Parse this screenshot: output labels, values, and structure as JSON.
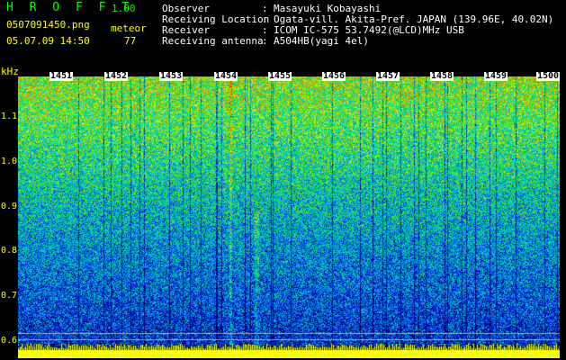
{
  "app": {
    "title": "H R O F F T",
    "version": "1.00"
  },
  "file": {
    "name": "0507091450.png",
    "datetime": "05.07.09 14:50"
  },
  "meteor": {
    "label": "meteor",
    "count": "77"
  },
  "info": [
    {
      "key": "Observer",
      "value": "Masayuki Kobayashi"
    },
    {
      "key": "Receiving Location",
      "value": "Ogata-vill. Akita-Pref. JAPAN (139.96E, 40.02N)"
    },
    {
      "key": "Receiver",
      "value": "ICOM IC-575 53.7492(@LCD)MHz USB"
    },
    {
      "key": "Receiving antenna",
      "value": "A504HB(yagi 4el)"
    }
  ],
  "separator": ":",
  "axis": {
    "unit": "kHz",
    "y_ticks": [
      "1.1",
      "1.0",
      "0.9",
      "0.8",
      "0.7",
      "0.6"
    ],
    "x_ticks": [
      "1451",
      "1452",
      "1453",
      "1454",
      "1455",
      "1456",
      "1457",
      "1458",
      "1459",
      "1500"
    ]
  },
  "colors": {
    "text": "#ffff00",
    "label": "#ffffff",
    "title": "#00ff00"
  }
}
